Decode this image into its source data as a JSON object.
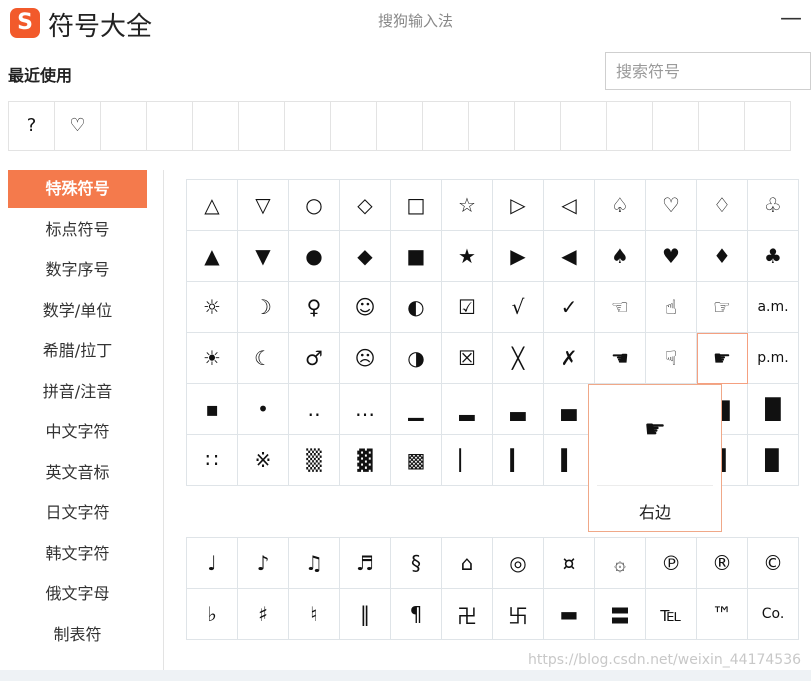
{
  "window": {
    "title": "符号大全",
    "subtitle": "搜狗输入法",
    "logo_letter": "S",
    "minimize": "—"
  },
  "recent": {
    "label": "最近使用",
    "items": [
      "?",
      "♡",
      "",
      "",
      "",
      "",
      "",
      "",
      "",
      "",
      "",
      "",
      "",
      "",
      "",
      "",
      ""
    ]
  },
  "search": {
    "placeholder": "搜索符号"
  },
  "sidebar": {
    "items": [
      {
        "label": "特殊符号",
        "active": true
      },
      {
        "label": "标点符号"
      },
      {
        "label": "数字序号"
      },
      {
        "label": "数学/单位"
      },
      {
        "label": "希腊/拉丁"
      },
      {
        "label": "拼音/注音"
      },
      {
        "label": "中文字符"
      },
      {
        "label": "英文音标"
      },
      {
        "label": "日文字符"
      },
      {
        "label": "韩文字符"
      },
      {
        "label": "俄文字母"
      },
      {
        "label": "制表符"
      }
    ]
  },
  "grid_primary": [
    [
      "△",
      "▽",
      "○",
      "◇",
      "□",
      "☆",
      "▷",
      "◁",
      "♤",
      "♡",
      "♢",
      "♧"
    ],
    [
      "▲",
      "▼",
      "●",
      "◆",
      "■",
      "★",
      "▶",
      "◀",
      "♠",
      "♥",
      "♦",
      "♣"
    ],
    [
      "☼",
      "☽",
      "♀",
      "☺",
      "◐",
      "☑",
      "√",
      "✓",
      "☜",
      "☝",
      "☞",
      "a.m."
    ],
    [
      "☀",
      "☾",
      "♂",
      "☹",
      "◑",
      "☒",
      "╳",
      "✗",
      "☚",
      "☟",
      "☛",
      "p.m."
    ],
    [
      "▪",
      "•",
      "‥",
      "…",
      "▁",
      "▂",
      "▃",
      "▄",
      "▅",
      "▆",
      "▇",
      "█"
    ],
    [
      "∷",
      "※",
      "▒",
      "▓",
      "▩",
      "▏",
      "▎",
      "▍",
      "▌",
      "▋",
      "▊",
      "▉"
    ]
  ],
  "grid_secondary": [
    [
      "♩",
      "♪",
      "♫",
      "♬",
      "§",
      "⌂",
      "◎",
      "¤",
      "۞",
      "℗",
      "®",
      "©"
    ],
    [
      "♭",
      "♯",
      "♮",
      "‖",
      "¶",
      "卍",
      "卐",
      "▬",
      "〓",
      "℡",
      "™",
      "Co."
    ]
  ],
  "tooltip": {
    "symbol": "☛",
    "label": "右边"
  },
  "watermark": "https://blog.csdn.net/weixin_44174536",
  "colors": {
    "accent": "#f47a4c",
    "logo": "#f25a2b",
    "grid_line": "#dfe4e8"
  }
}
